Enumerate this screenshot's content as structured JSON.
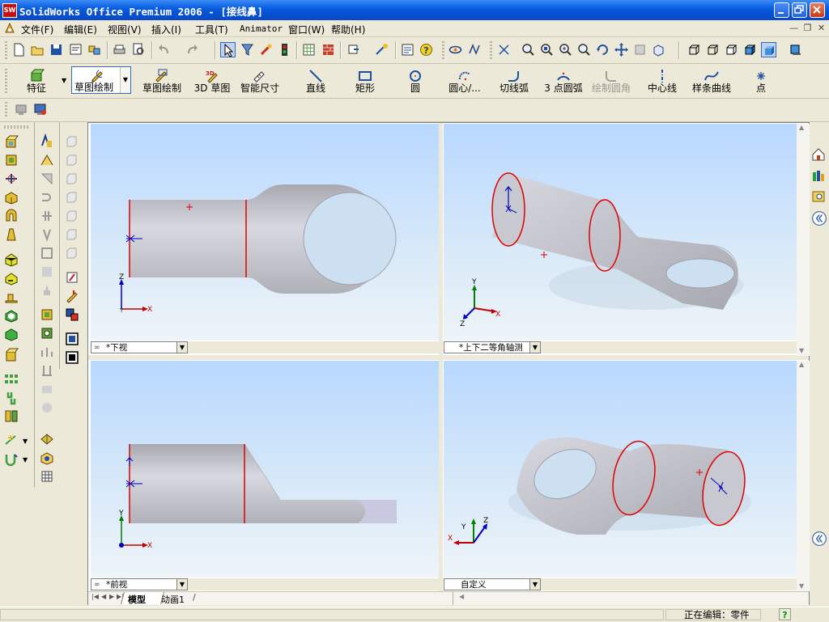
{
  "window": {
    "title": "SolidWorks Office Premium 2006 - [接线鼻]",
    "app_logo": "SW"
  },
  "menu": [
    {
      "label": "文件(F)"
    },
    {
      "label": "编辑(E)"
    },
    {
      "label": "视图(V)"
    },
    {
      "label": "插入(I)"
    },
    {
      "label": "工具(T)"
    },
    {
      "label": "Animator"
    },
    {
      "label": "窗口(W)"
    },
    {
      "label": "帮助(H)"
    }
  ],
  "sketch_toolbar": {
    "features_label": "特征",
    "sketch_label": "草图绘制",
    "items": [
      {
        "label": "草图绘制"
      },
      {
        "label": "3D 草图"
      },
      {
        "label": "智能尺寸"
      },
      {
        "label": "直线"
      },
      {
        "label": "矩形"
      },
      {
        "label": "圆"
      },
      {
        "label": "圆心/..."
      },
      {
        "label": "切线弧"
      },
      {
        "label": "3 点圆弧"
      },
      {
        "label": "绘制圆角"
      },
      {
        "label": "中心线"
      },
      {
        "label": "样条曲线"
      },
      {
        "label": "点"
      }
    ]
  },
  "viewports": [
    {
      "view_name": "*下视"
    },
    {
      "view_name": "*上下二等角轴测"
    },
    {
      "view_name": "*前视"
    },
    {
      "view_name": "自定义"
    }
  ],
  "bottom_tabs": [
    {
      "label": "模型"
    },
    {
      "label": "动画1"
    }
  ],
  "status": {
    "editing": "正在编辑：零件",
    "help": "?"
  },
  "colors": {
    "titlebar": "#0a5fe0",
    "edge_highlight": "#e00000",
    "part": "#c8c8d0"
  }
}
